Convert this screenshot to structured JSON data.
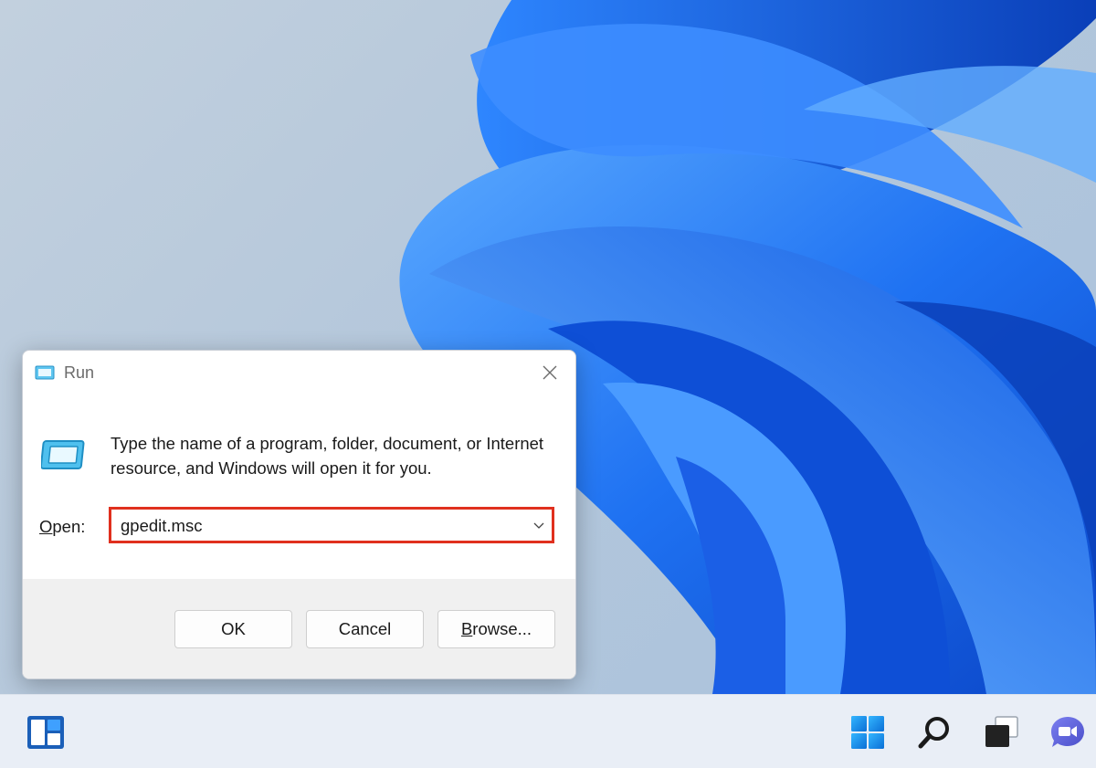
{
  "dialog": {
    "title": "Run",
    "description": "Type the name of a program, folder, document, or Internet resource, and Windows will open it for you.",
    "open_label_accel": "O",
    "open_label_rest": "pen:",
    "open_value": "gpedit.msc",
    "buttons": {
      "ok": "OK",
      "cancel": "Cancel",
      "browse_accel": "B",
      "browse_rest": "rowse..."
    }
  },
  "icons": {
    "title": "run-app-icon",
    "content": "run-app-icon",
    "close": "close-icon",
    "dropdown": "chevron-down-icon"
  },
  "taskbar": {
    "items": [
      "widgets-icon",
      "start-windows-icon",
      "search-icon",
      "task-view-icon",
      "chat-icon"
    ]
  },
  "colors": {
    "highlight_border": "#e0301e",
    "wallpaper_blue": "#1a6cf0",
    "accent": "#0078d4"
  }
}
